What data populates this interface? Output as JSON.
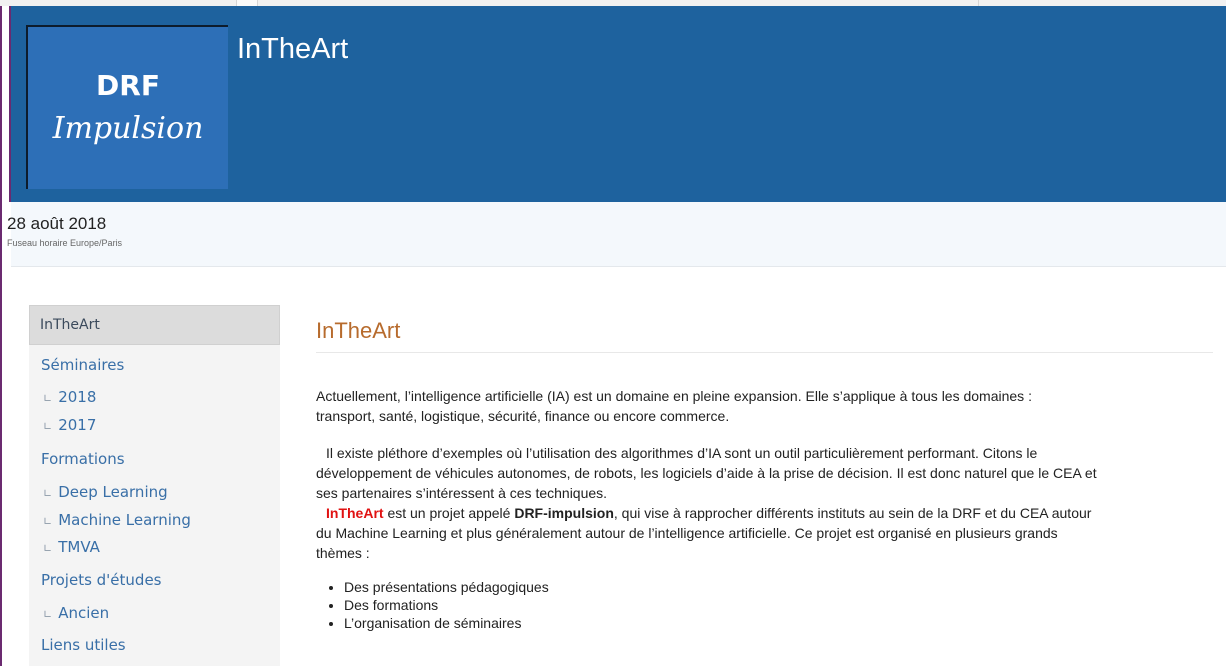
{
  "header": {
    "logo_line1": "DRF",
    "logo_line2": "Impulsion",
    "title": "InTheArt"
  },
  "datebar": {
    "date": "28 août 2018",
    "timezone": "Fuseau horaire Europe/Paris"
  },
  "sidebar": {
    "top": "InTheArt",
    "seminaires": "Séminaires",
    "sem_2018": "2018",
    "sem_2017": "2017",
    "formations": "Formations",
    "deep_learning": "Deep Learning",
    "machine_learning": "Machine Learning",
    "tmva": "TMVA",
    "projets": "Projets d'études",
    "ancien": "Ancien",
    "liens": "Liens utiles",
    "tick": "∟"
  },
  "main": {
    "title": "InTheArt",
    "p1_l1": "Actuellement, l’intelligence artificielle (IA) est un domaine en pleine expansion. Elle s’applique à tous les domaines :",
    "p1_l2": "transport, santé, logistique, sécurité, finance ou encore commerce.",
    "p2_l1": "Il existe pléthore d’exemples où l’utilisation des algorithmes d’IA sont un outil particulièrement performant. Citons le",
    "p2_l2": "développement de véhicules autonomes, de robots, les logiciels d’aide à la prise de décision. Il est donc naturel que le CEA et",
    "p2_l3": "ses partenaires s’intéressent à ces techniques.",
    "p3_name": "InTheArt",
    "p3_mid": " est un projet appelé ",
    "p3_bold": "DRF-impulsion",
    "p3_rest": ", qui vise à rapprocher différents instituts au sein de la DRF et du CEA autour",
    "p3_l2": "du Machine Learning et plus généralement autour de l’intelligence artificielle. Ce projet est organisé en plusieurs grands",
    "p3_l3": "thèmes :",
    "bullets": [
      "Des présentations pédagogiques",
      "Des formations",
      "L’organisation de séminaires"
    ]
  }
}
